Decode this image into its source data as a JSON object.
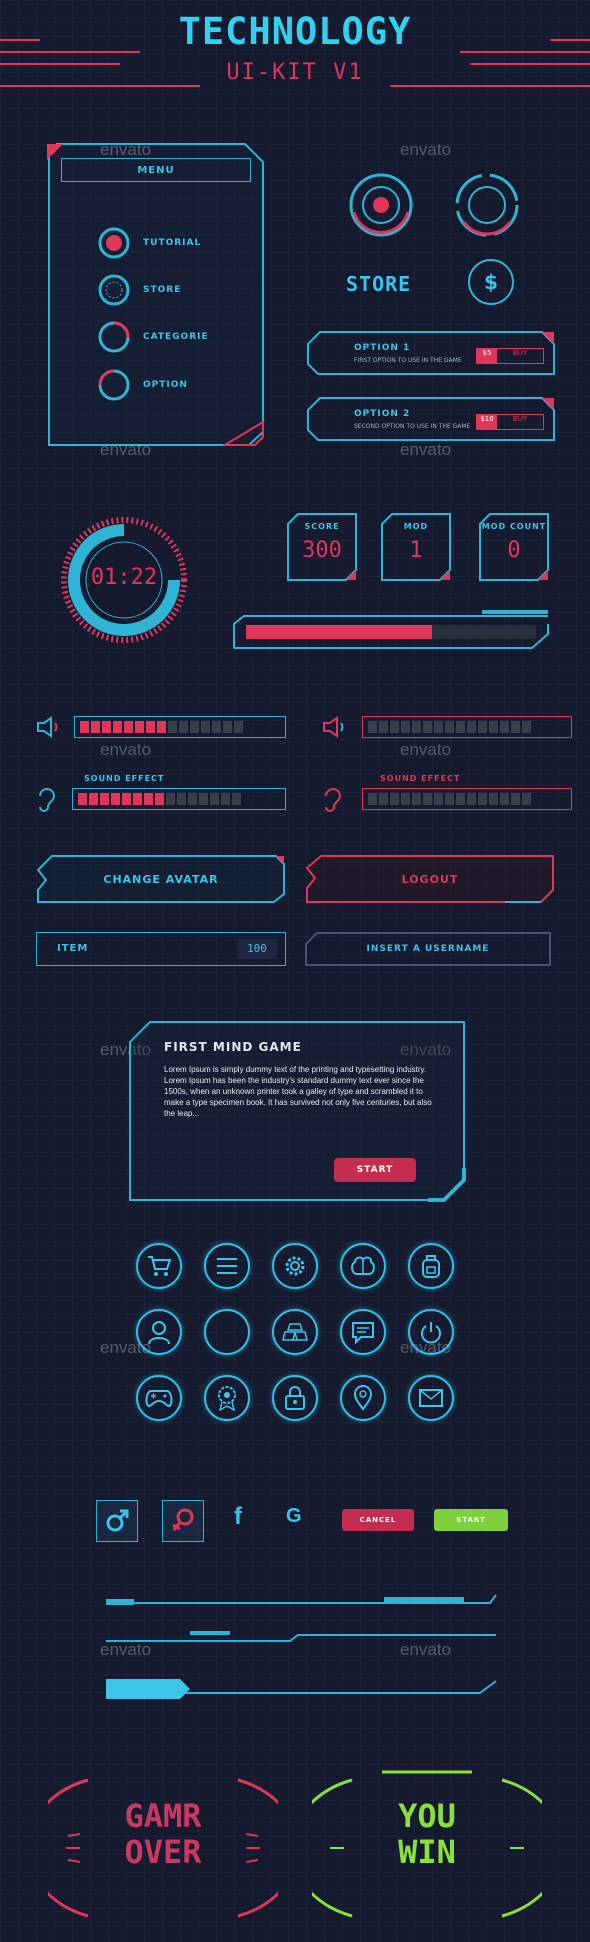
{
  "header": {
    "title": "TECHNOLOGY",
    "subtitle": "UI-KIT V1"
  },
  "watermark": "envato",
  "menu": {
    "title": "MENU",
    "items": [
      {
        "label": "TUTORIAL",
        "icon": "target-icon"
      },
      {
        "label": "STORE",
        "icon": "ring-icon"
      },
      {
        "label": "CATEGORIE",
        "icon": "ring-icon"
      },
      {
        "label": "OPTION",
        "icon": "ring-icon"
      }
    ]
  },
  "store": {
    "title": "STORE",
    "currency_symbol": "$",
    "options": [
      {
        "title": "OPTION 1",
        "desc": "FIRST OPTION TO USE IN THE GAME",
        "price": "$5",
        "buy": "BUY"
      },
      {
        "title": "OPTION 2",
        "desc": "SECOND OPTION TO USE IN THE GAME",
        "price": "$10",
        "buy": "BUY"
      }
    ]
  },
  "timer": {
    "value": "01:22"
  },
  "stats": [
    {
      "label": "SCORE",
      "value": "300"
    },
    {
      "label": "MOD",
      "value": "1"
    },
    {
      "label": "MOD COUNT",
      "value": "0"
    }
  ],
  "progress": {
    "fraction": 0.64
  },
  "sound": {
    "effect_label": "SOUND EFFECT",
    "bars": [
      {
        "filled": 8,
        "total": 15
      },
      {
        "filled": 0,
        "total": 15
      },
      {
        "filled": 8,
        "total": 15
      },
      {
        "filled": 0,
        "total": 15
      }
    ]
  },
  "buttons": {
    "change_avatar": "CHANGE AVATAR",
    "logout": "LOGOUT",
    "item_label": "ITEM",
    "item_value": "100",
    "username_placeholder": "INSERT A USERNAME"
  },
  "dialog": {
    "title": "FIRST MIND GAME",
    "body": "Lorem Ipsum is simply dummy text of the printing and typesetting industry. Lorem Ipsum has been the industry's standard dummy text ever since the 1500s, when an unknown printer took a galley of type and scrambled it to make a type specimen book. It has survived not only five centuries, but also the leap...",
    "start": "START"
  },
  "icons": [
    "cart-icon",
    "menu-icon",
    "gear-icon",
    "brain-icon",
    "backpack-icon",
    "user-icon",
    "blank-icon",
    "gold-icon",
    "chat-icon",
    "power-icon",
    "gamepad-icon",
    "badge-icon",
    "lock-icon",
    "location-icon",
    "mail-icon"
  ],
  "social": {
    "facebook": "f",
    "google": "G",
    "cancel": "CANCEL",
    "start": "START"
  },
  "end": {
    "game_over": [
      "GAMR",
      "OVER"
    ],
    "you_win": [
      "YOU",
      "WIN"
    ]
  },
  "colors": {
    "cyan": "#3ec4e8",
    "red": "#e0365a",
    "green": "#8be03a",
    "bg": "#161a2e"
  }
}
